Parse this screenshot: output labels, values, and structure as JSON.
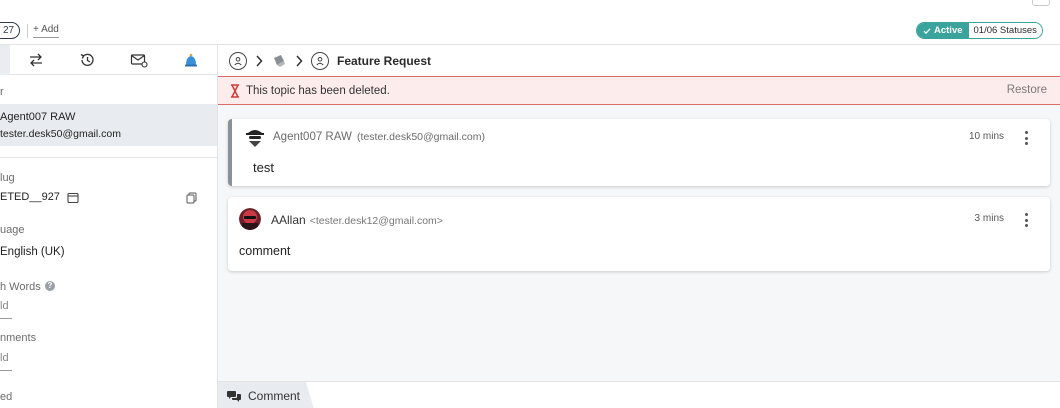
{
  "topbar": {
    "id_pill": "27",
    "add_label": "+ Add",
    "status_label": "Active",
    "status_count": "01/06 Statuses"
  },
  "left_panel": {
    "tabs": [
      "assignee-icon",
      "swap-icon",
      "history-icon",
      "mail-link-icon",
      "bell-icon"
    ],
    "assignee_label": "r",
    "assignee_name": "Agent007 RAW",
    "assignee_email": "tester.desk50@gmail.com",
    "slug_label": "lug",
    "slug_value": "ETED__927",
    "language_label": "uage",
    "language_value": "English (UK)",
    "words_label": "h Words",
    "words_value": "ld",
    "comments_label": "nments",
    "comments_value": "ld",
    "last_label": "ed"
  },
  "breadcrumb": {
    "title": "Feature Request"
  },
  "banner": {
    "message": "This topic has been deleted.",
    "restore": "Restore"
  },
  "posts": [
    {
      "author": "Agent007 RAW",
      "email": "(tester.desk50@gmail.com)",
      "time": "10 mins",
      "text": "test"
    },
    {
      "author": "AAllan",
      "email": "<tester.desk12@gmail.com>",
      "time": "3 mins",
      "text": "comment"
    }
  ],
  "composer": {
    "tab_label": "Comment"
  },
  "colors": {
    "accent": "#3aa39b",
    "banner_bg": "#fdecec",
    "banner_border": "#d96b6b"
  }
}
